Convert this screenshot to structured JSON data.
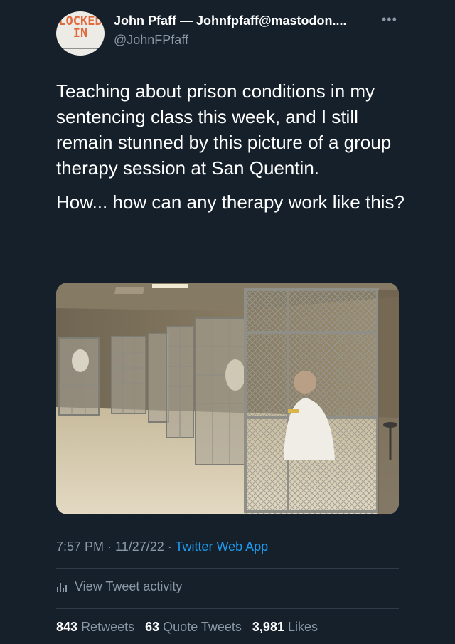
{
  "author": {
    "avatar_text_line1": "LOCKED",
    "avatar_text_line2": "IN",
    "display_name": "John Pfaff — Johnfpfaff@mastodon....",
    "handle": "@JohnFPfaff"
  },
  "more_icon": "more-horizontal-icon",
  "tweet": {
    "paragraph1": "Teaching about prison conditions in my sentencing class this week, and I still remain stunned by this picture of a group therapy session at San Quentin.",
    "paragraph2": "How... how can any therapy work like this?"
  },
  "meta": {
    "time": "7:57 PM",
    "sep1": " · ",
    "date": "11/27/22",
    "sep2": " · ",
    "source": "Twitter Web App"
  },
  "activity": {
    "icon": "bar-chart-icon",
    "label": "View Tweet activity"
  },
  "stats": {
    "retweets_count": "843",
    "retweets_label": "Retweets",
    "quotes_count": "63",
    "quotes_label": "Quote Tweets",
    "likes_count": "3,981",
    "likes_label": "Likes"
  },
  "colors": {
    "background": "#15202b",
    "secondary_text": "#8b98a5",
    "link": "#1d9bf0",
    "divider": "#2f3b47"
  }
}
